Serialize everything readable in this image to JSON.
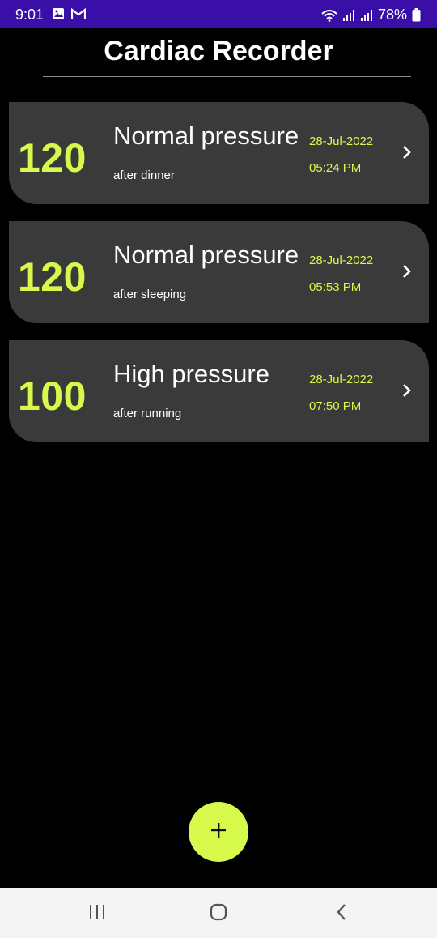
{
  "status_bar": {
    "time": "9:01",
    "battery": "78%",
    "icons": [
      "image-icon",
      "gmail-icon",
      "wifi-icon",
      "signal-icon",
      "signal-icon",
      "battery-icon"
    ]
  },
  "header": {
    "title": "Cardiac Recorder"
  },
  "records": [
    {
      "reading": "120",
      "status": "Normal pressure",
      "note": "after dinner",
      "date": "28-Jul-2022",
      "time": "05:24 PM"
    },
    {
      "reading": "120",
      "status": "Normal pressure",
      "note": "after sleeping",
      "date": "28-Jul-2022",
      "time": "05:53 PM"
    },
    {
      "reading": "100",
      "status": "High pressure",
      "note": "after running",
      "date": "28-Jul-2022",
      "time": "07:50 PM"
    }
  ],
  "fab": {
    "icon": "plus-icon"
  },
  "nav": {
    "icons": [
      "recents-icon",
      "home-icon",
      "back-icon"
    ]
  },
  "colors": {
    "accent": "#d6f94c",
    "card": "#3a3a3a",
    "status_bar": "#3a0fa8",
    "background": "#000000"
  }
}
